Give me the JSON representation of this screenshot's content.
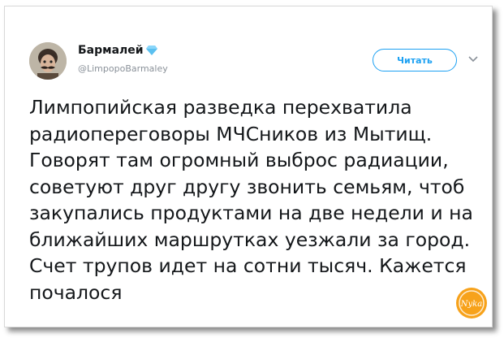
{
  "tweet": {
    "author_name": "Бармалей",
    "handle": "@LimpopoBarmaley",
    "follow_label": "Читать",
    "text": "Лимпопийская разведка перехватила\nрадиопереговоры МЧСников из Мытищ.\nГоворят там огромный выброс радиации,\nсоветуют друг другу звонить семьям, чтоб\nзакупались продуктами на две недели и на\nближайших маршрутках уезжали за город.\nСчет трупов идет на сотни тысяч. Кажется\nпочалося"
  },
  "watermark": {
    "text": "Nyka"
  },
  "colors": {
    "accent": "#1da1f2",
    "text": "#14171a",
    "muted": "#8a9199",
    "watermark": "#f7a21b"
  },
  "icons": {
    "verified": "diamond-icon",
    "menu": "chevron-down-icon"
  }
}
